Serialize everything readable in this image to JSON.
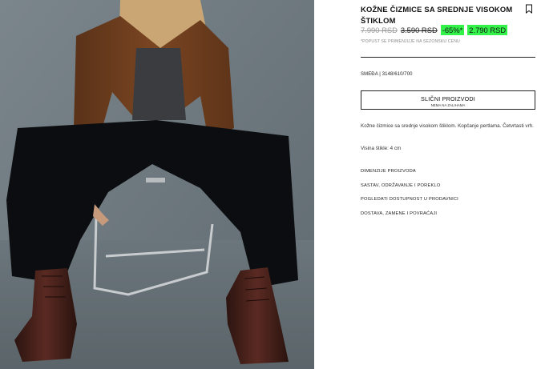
{
  "product": {
    "title": "KOŽNE ČIZMICE SA SREDNJE VISOKOM ŠTIKLOM",
    "price_original": "7.990 RSD",
    "price_previous": "3.590 RSD",
    "discount": "-65%*",
    "price_current": "2.790 RSD",
    "discount_note": "*POPUST SE PRIMENJUJE NA SEZONSKU CENU",
    "color_ref": "SMEĐA | 3148/610/700",
    "description": "Kožne čizmice sa srednje visokom štiklom. Kopčanje pertlama. Četvrtasti vrh.",
    "heel_height": "Visina štikle: 4 cm"
  },
  "similar_button": {
    "label": "SLIČNI PROIZVODI",
    "sublabel": "NEMA NA ZALIHAMA"
  },
  "links": [
    "DIMENZIJE PROIZVODA",
    "SASTAV, ODRŽAVANJE I POREKLO",
    "POGLEDATI DOSTUPNOST U PRODAVNICI",
    "DOSTAVA, ZAMENE I POVRAĆAJI"
  ],
  "icons": {
    "bookmark": "bookmark-icon"
  },
  "colors": {
    "discount_highlight": "#33f24a",
    "photo_background": "#6f7a80"
  }
}
